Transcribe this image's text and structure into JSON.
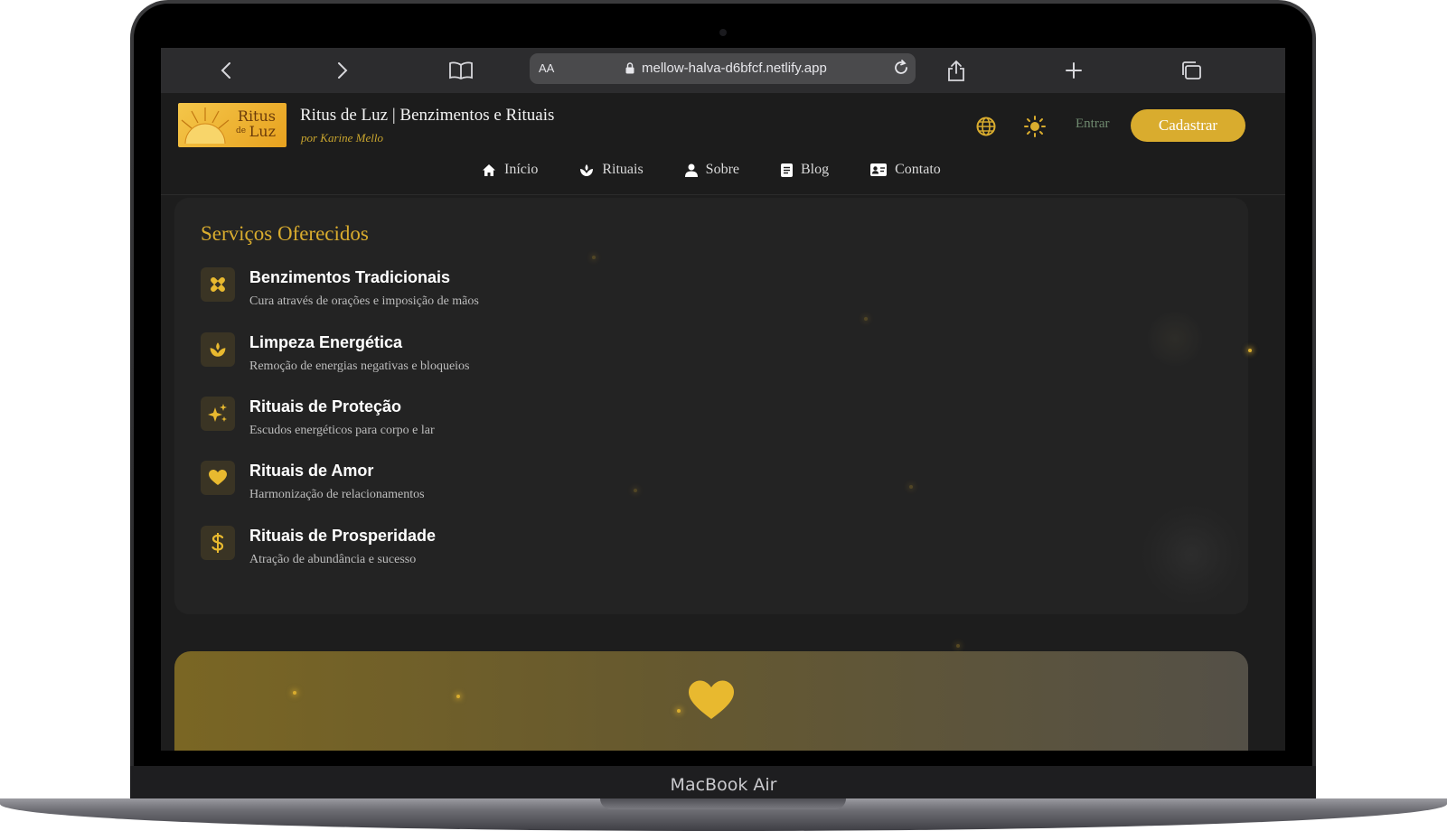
{
  "device": {
    "label": "MacBook Air"
  },
  "browser": {
    "text_size_label": "AA",
    "url": "mellow-halva-d6bfcf.netlify.app"
  },
  "site": {
    "logo": {
      "line1": "Ritus",
      "line2": "Luz",
      "small": "de"
    },
    "title": "Ritus de Luz | Benzimentos e Rituais",
    "byline": "por Karine Mello",
    "login_label": "Entrar",
    "signup_label": "Cadastrar",
    "nav": [
      {
        "label": "Início",
        "icon": "home-icon"
      },
      {
        "label": "Rituais",
        "icon": "lotus-icon"
      },
      {
        "label": "Sobre",
        "icon": "user-icon"
      },
      {
        "label": "Blog",
        "icon": "document-icon"
      },
      {
        "label": "Contato",
        "icon": "contact-card-icon"
      }
    ]
  },
  "services": {
    "title": "Serviços Oferecidos",
    "items": [
      {
        "name": "Benzimentos Tradicionais",
        "description": "Cura através de orações e imposição de mãos",
        "icon": "bandage-icon"
      },
      {
        "name": "Limpeza Energética",
        "description": "Remoção de energias negativas e bloqueios",
        "icon": "lotus-icon"
      },
      {
        "name": "Rituais de Proteção",
        "description": "Escudos energéticos para corpo e lar",
        "icon": "sparkles-icon"
      },
      {
        "name": "Rituais de Amor",
        "description": "Harmonização de relacionamentos",
        "icon": "heart-icon"
      },
      {
        "name": "Rituais de Prosperidade",
        "description": "Atração de abundância e sucesso",
        "icon": "dollar-icon"
      }
    ]
  },
  "colors": {
    "accent": "#d9ac2e",
    "background": "#1d1d1d",
    "card": "#232323"
  }
}
